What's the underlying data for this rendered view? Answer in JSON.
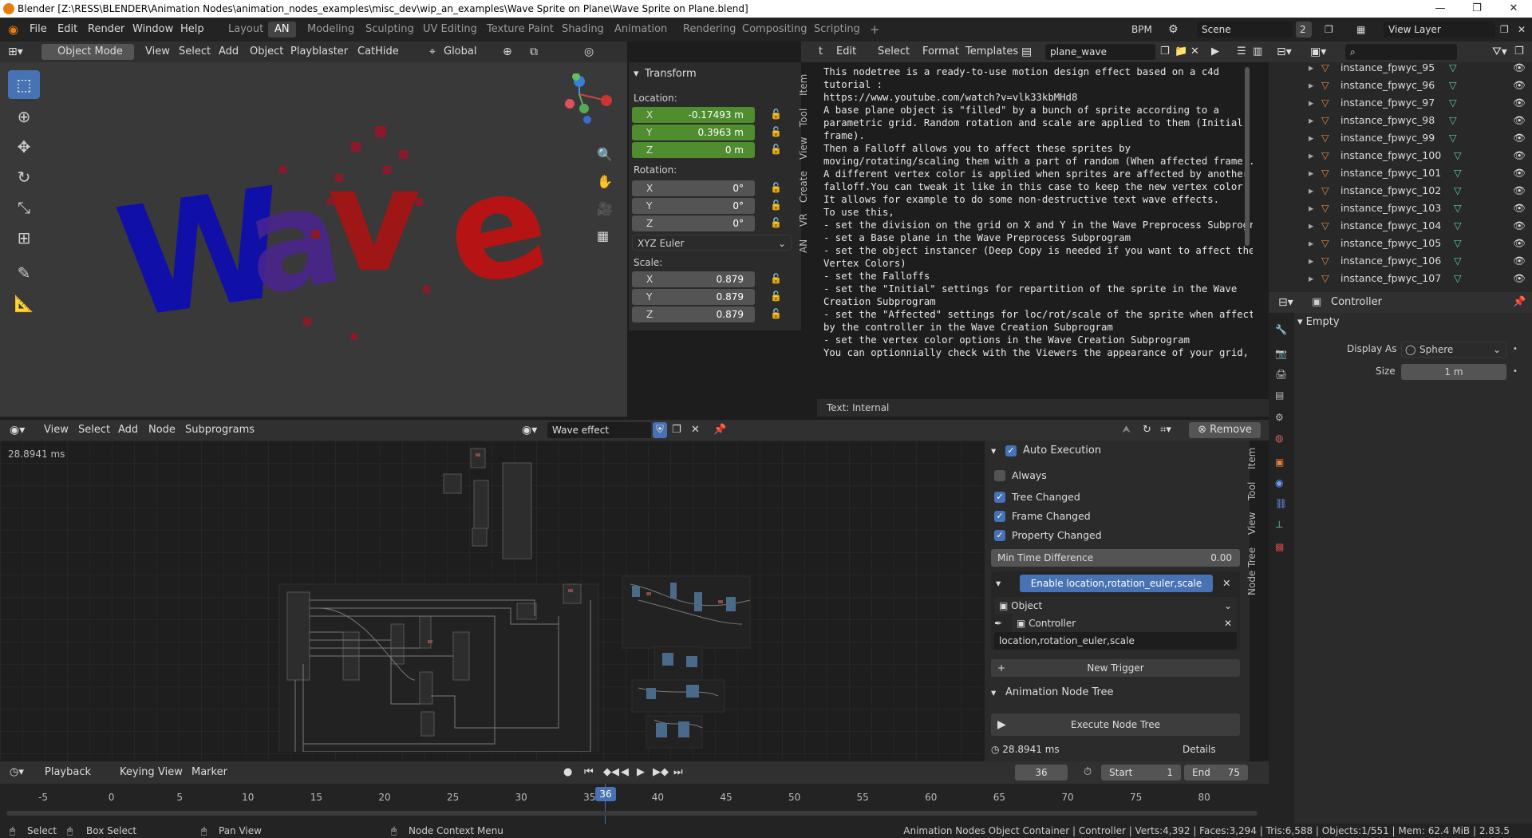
{
  "window": {
    "title": "Blender [Z:\\RESS\\BLENDER\\Animation Nodes\\animation_nodes_examples\\misc_dev\\wip_an_examples\\Wave Sprite on Plane\\Wave Sprite on Plane.blend]",
    "minimize": "—",
    "maximize": "❐",
    "close": "✕"
  },
  "topbar": {
    "menus": [
      "File",
      "Edit",
      "Render",
      "Window",
      "Help"
    ],
    "workspaces": [
      "Layout",
      "AN",
      "Modeling",
      "Sculpting",
      "UV Editing",
      "Texture Paint",
      "Shading",
      "Animation",
      "Rendering",
      "Compositing",
      "Scripting"
    ],
    "active_workspace": "AN",
    "add_workspace": "+",
    "bpm": "BPM",
    "scene": "Scene",
    "scene_users": "2",
    "view_layer": "View Layer"
  },
  "viewport_header": {
    "mode": "Object Mode",
    "menus": [
      "View",
      "Select",
      "Add",
      "Object",
      "Playblaster",
      "CatHide"
    ],
    "orientation": "Global"
  },
  "viewport": {
    "wave_letters": [
      "W",
      "a",
      "v",
      "e"
    ],
    "colors": {
      "blue": "#1010a8",
      "purple": "#5c2a7e",
      "red": "#c01010"
    }
  },
  "transform": {
    "title": "Transform",
    "location_label": "Location:",
    "location": [
      {
        "axis": "X",
        "value": "-0.17493 m"
      },
      {
        "axis": "Y",
        "value": "0.3963 m"
      },
      {
        "axis": "Z",
        "value": "0 m"
      }
    ],
    "rotation_label": "Rotation:",
    "rotation": [
      {
        "axis": "X",
        "value": "0°"
      },
      {
        "axis": "Y",
        "value": "0°"
      },
      {
        "axis": "Z",
        "value": "0°"
      }
    ],
    "rotation_mode": "XYZ Euler",
    "scale_label": "Scale:",
    "scale": [
      {
        "axis": "X",
        "value": "0.879"
      },
      {
        "axis": "Y",
        "value": "0.879"
      },
      {
        "axis": "Z",
        "value": "0.879"
      }
    ],
    "side_tabs": [
      "Item",
      "Tool",
      "View",
      "Create",
      "VR",
      "AN"
    ]
  },
  "text_editor": {
    "menus": [
      "Edit",
      "Select",
      "Format",
      "Templates"
    ],
    "partial_menu": "t",
    "datablock": "plane_wave",
    "lines": [
      "This nodetree is a ready-to-use motion design effect based on a c4d",
      "tutorial :",
      "https://www.youtube.com/watch?v=vlk33kbMHd8",
      "",
      "A base plane object is \"filled\" by a bunch of sprite according to a",
      "parametric grid. Random rotation and scale are applied to them (Initial",
      "frame).",
      "Then a Falloff allows you to affect these sprites by",
      "moving/rotating/scaling them with a part of random (When affected frame).",
      "A different vertex color is applied when sprites are affected by another",
      "falloff.You can tweak it like in this case to keep the new vertex color.",
      "It allows for example to do some non-destructive text wave effects.",
      "",
      "To use this,",
      "- set the division on the grid on X and Y in the Wave Preprocess Subprogram",
      "- set a Base plane in the Wave Preprocess Subprogram",
      "- set the object instancer (Deep Copy is needed if you want to affect the",
      "Vertex Colors)",
      "- set the Falloffs",
      "- set the \"Initial\" settings for repartition of the sprite in the Wave",
      "Creation Subprogram",
      "- set the \"Affected\" settings for loc/rot/scale of the sprite when affected",
      "by the controller in the Wave Creation Subprogram",
      "- set the vertex color options in the Wave Creation Subprogram",
      "",
      "You can optionnially check with the Viewers the appearance of your grid,"
    ],
    "footer": "Text: Internal"
  },
  "outliner": {
    "items": [
      "instance_fpwyc_95",
      "instance_fpwyc_96",
      "instance_fpwyc_97",
      "instance_fpwyc_98",
      "instance_fpwyc_99",
      "instance_fpwyc_100",
      "instance_fpwyc_101",
      "instance_fpwyc_102",
      "instance_fpwyc_103",
      "instance_fpwyc_104",
      "instance_fpwyc_105",
      "instance_fpwyc_106",
      "instance_fpwyc_107"
    ]
  },
  "properties": {
    "object_name": "Controller",
    "section": "Empty",
    "display_as_label": "Display As",
    "display_as": "Sphere",
    "size_label": "Size",
    "size": "1 m"
  },
  "node_editor": {
    "menus": [
      "View",
      "Select",
      "Add",
      "Node",
      "Subprograms"
    ],
    "tree_name": "Wave effect",
    "remove": "Remove",
    "exec_time": "28.8941 ms",
    "side_tabs": [
      "Item",
      "Tool",
      "View",
      "Node Tree"
    ]
  },
  "auto_execution": {
    "title": "Auto Execution",
    "always": "Always",
    "tree_changed": "Tree Changed",
    "frame_changed": "Frame Changed",
    "property_changed": "Property Changed",
    "min_time_label": "Min Time Difference",
    "min_time_value": "0.00",
    "trigger_label": "Enable location,rotation_euler,scale",
    "trigger_type": "Object",
    "trigger_object": "Controller",
    "trigger_props": "location,rotation_euler,scale",
    "new_trigger": "New Trigger",
    "ant_title": "Animation Node Tree",
    "execute": "Execute Node Tree",
    "exec_time": "28.8941 ms",
    "details": "Details"
  },
  "timeline": {
    "menus": [
      "Playback",
      "Keying",
      "View",
      "Marker"
    ],
    "current_frame": "36",
    "start_label": "Start",
    "start": "1",
    "end_label": "End",
    "end": "75",
    "ticks": [
      "-5",
      "0",
      "5",
      "10",
      "15",
      "20",
      "25",
      "30",
      "35",
      "40",
      "45",
      "50",
      "55",
      "60",
      "65",
      "70",
      "75",
      "80"
    ]
  },
  "statusbar": {
    "select": "Select",
    "box_select": "Box Select",
    "pan_view": "Pan View",
    "node_context": "Node Context Menu",
    "stats": "Animation Nodes Object Container | Controller | Verts:4,392 | Faces:3,294 | Tris:6,588 | Objects:1/551 | Mem: 62.4 MiB | 2.83.5"
  }
}
